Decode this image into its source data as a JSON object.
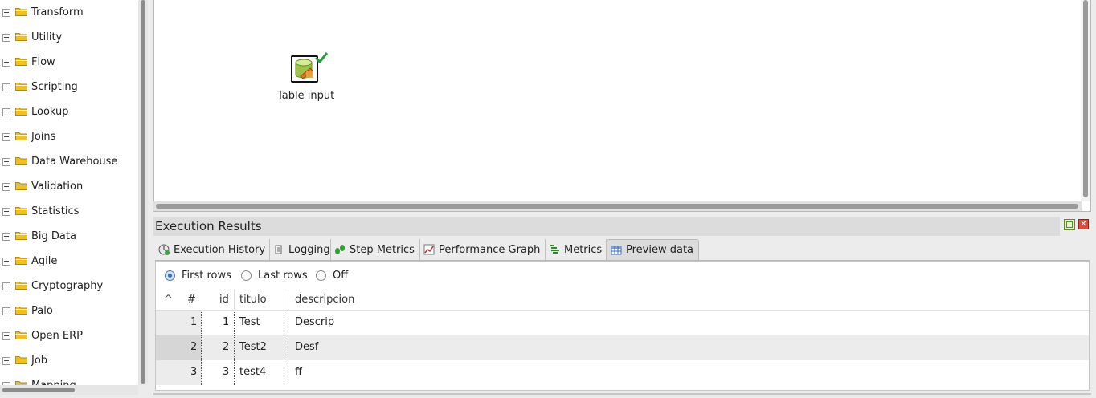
{
  "tree": {
    "items": [
      {
        "label": "Transform"
      },
      {
        "label": "Utility"
      },
      {
        "label": "Flow"
      },
      {
        "label": "Scripting"
      },
      {
        "label": "Lookup"
      },
      {
        "label": "Joins"
      },
      {
        "label": "Data Warehouse"
      },
      {
        "label": "Validation"
      },
      {
        "label": "Statistics"
      },
      {
        "label": "Big Data"
      },
      {
        "label": "Agile"
      },
      {
        "label": "Cryptography"
      },
      {
        "label": "Palo"
      },
      {
        "label": "Open ERP"
      },
      {
        "label": "Job"
      },
      {
        "label": "Mapping"
      }
    ]
  },
  "canvas": {
    "step": {
      "label": "Table input",
      "icon": "table-input-icon",
      "status_icon": "checkmark-icon"
    }
  },
  "results": {
    "title": "Execution Results",
    "tabs": [
      {
        "label": "Execution History",
        "icon": "history-icon"
      },
      {
        "label": "Logging",
        "icon": "logging-icon"
      },
      {
        "label": "Step Metrics",
        "icon": "step-metrics-icon"
      },
      {
        "label": "Performance Graph",
        "icon": "graph-icon"
      },
      {
        "label": "Metrics",
        "icon": "metrics-icon"
      },
      {
        "label": "Preview data",
        "icon": "table-icon"
      }
    ],
    "active_tab": "Preview data",
    "preview": {
      "radio_options": [
        {
          "label": "First rows",
          "checked": true
        },
        {
          "label": "Last rows",
          "checked": false
        },
        {
          "label": "Off",
          "checked": false
        }
      ],
      "columns": [
        "^",
        "#",
        "id",
        "titulo",
        "descripcion"
      ],
      "rows": [
        {
          "num": "1",
          "id": "1",
          "titulo": "Test",
          "descripcion": "Descrip"
        },
        {
          "num": "2",
          "id": "2",
          "titulo": "Test2",
          "descripcion": "Desf"
        },
        {
          "num": "3",
          "id": "3",
          "titulo": "test4",
          "descripcion": "ff"
        }
      ]
    }
  },
  "colors": {
    "folder": "#f0c020",
    "checkmark": "#2a9a3a",
    "close": "#e04a3a",
    "radio_selected": "#3a6cb0"
  }
}
